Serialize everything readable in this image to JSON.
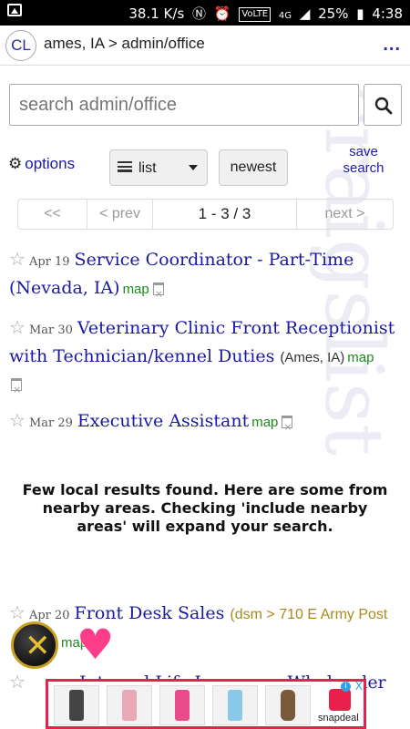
{
  "status_bar": {
    "speed": "38.1 K/s",
    "network_badge": "VoLTE",
    "network_type": "4G",
    "battery": "25%",
    "time": "4:38",
    "icons": [
      "image-icon",
      "nfc-icon",
      "alarm-icon",
      "volte-icon",
      "signal-icon",
      "battery-icon"
    ]
  },
  "header": {
    "logo": "CL",
    "breadcrumb": "ames, IA > admin/office",
    "more": "..."
  },
  "search": {
    "placeholder": "search admin/office"
  },
  "controls": {
    "options_label": "options",
    "view_mode": "list",
    "sort_label": "newest",
    "save_search_line1": "save",
    "save_search_line2": "search"
  },
  "pager": {
    "first": "<<",
    "prev": "< prev",
    "range": "1 - 3 / 3",
    "next": "next >"
  },
  "watermark": "craigslist",
  "results": [
    {
      "date": "Apr 19",
      "title": "Service Coordinator - Part-Time (Nevada, IA)",
      "hood": "",
      "map": "map"
    },
    {
      "date": "Mar 30",
      "title": "Veterinary Clinic Front Receptionist with Technician/kennel Duties",
      "hood": "(Ames, IA)",
      "map": "map"
    },
    {
      "date": "Mar 29",
      "title": "Executive Assistant",
      "hood": "",
      "map": "map"
    }
  ],
  "nearby_note": "Few local results found. Here are some from nearby areas. Checking 'include nearby areas' will expand your search.",
  "nearby_results": [
    {
      "date": "Apr 20",
      "title": "Front Desk Sales",
      "hood": "(dsm > 710 E Army Post",
      "map": "map"
    },
    {
      "date": "",
      "title": "Internal Life Insurance Wholesaler",
      "hood": "",
      "map": ""
    }
  ],
  "ad": {
    "brand": "snapdeal",
    "info": "i",
    "close": "X"
  },
  "colors": {
    "link": "#1a1a9e",
    "map": "#1d8a1d",
    "ad_border": "#e8204a"
  }
}
